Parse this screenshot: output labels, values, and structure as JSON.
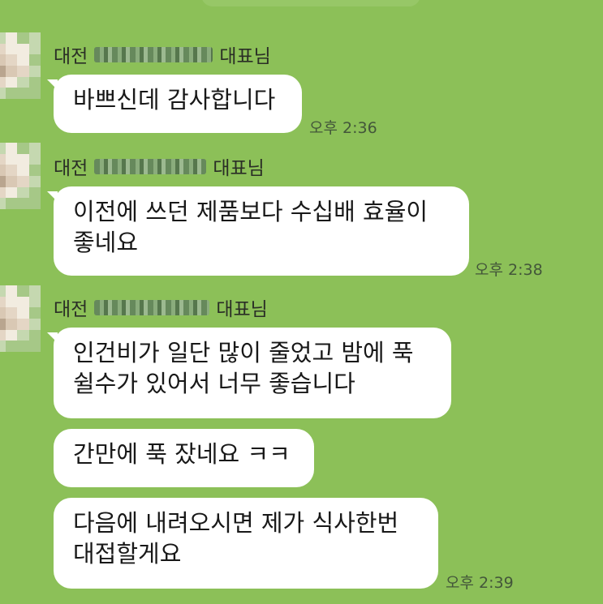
{
  "chat": {
    "groups": [
      {
        "sender_prefix": "대전",
        "sender_suffix": "대표님",
        "time": "오후 2:36",
        "messages": [
          "바쁘신데 감사합니다"
        ]
      },
      {
        "sender_prefix": "대전",
        "sender_suffix": "대표님",
        "time": "오후 2:38",
        "messages": [
          "이전에 쓰던 제품보다 수십배 효율이\n좋네요"
        ]
      },
      {
        "sender_prefix": "대전",
        "sender_suffix": "대표님",
        "time": "오후 2:39",
        "messages": [
          "인건비가 일단 많이 줄었고 밤에 푹\n쉴수가 있어서 너무 좋습니다",
          "간만에 푹 잤네요 ㅋㅋ",
          "다음에 내려오시면 제가 식사한번\n대접할게요"
        ]
      }
    ]
  },
  "colors": {
    "background": "#8cc058",
    "bubble": "#ffffff",
    "text": "#181818",
    "timestamp": "#43563a"
  }
}
